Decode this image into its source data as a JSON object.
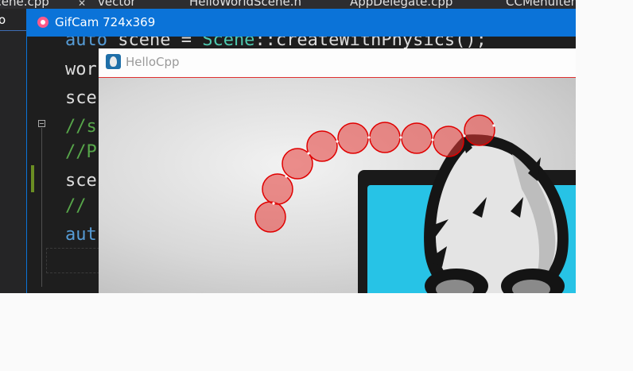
{
  "ide": {
    "tabs": [
      "Scene.cpp",
      "vector",
      "HelloWorldScene.h",
      "AppDelegate.cpp",
      "CCMenuItem"
    ],
    "left_pane_label": "o",
    "close_glyph": "✕",
    "code": {
      "line1": [
        "auto",
        " scene = ",
        "Scene",
        "::createWithPhysics();"
      ],
      "line2": "wor",
      "line3": "sce",
      "line4": "//s",
      "line5": "//P",
      "line6": "sce",
      "line7": "//",
      "line8": "aut"
    }
  },
  "gifcam": {
    "title": "GifCam 724x369"
  },
  "hello": {
    "title": "HelloCpp"
  },
  "colors": {
    "gifcam_title_bg": "#0b73d8",
    "ball_fill": "#e53935",
    "ball_stroke": "#e00000",
    "logo_cyan": "#27c3e6"
  },
  "scene": {
    "objects": [
      "physics-ball-chain",
      "cocos2d-logo"
    ],
    "ball_count": 9
  }
}
